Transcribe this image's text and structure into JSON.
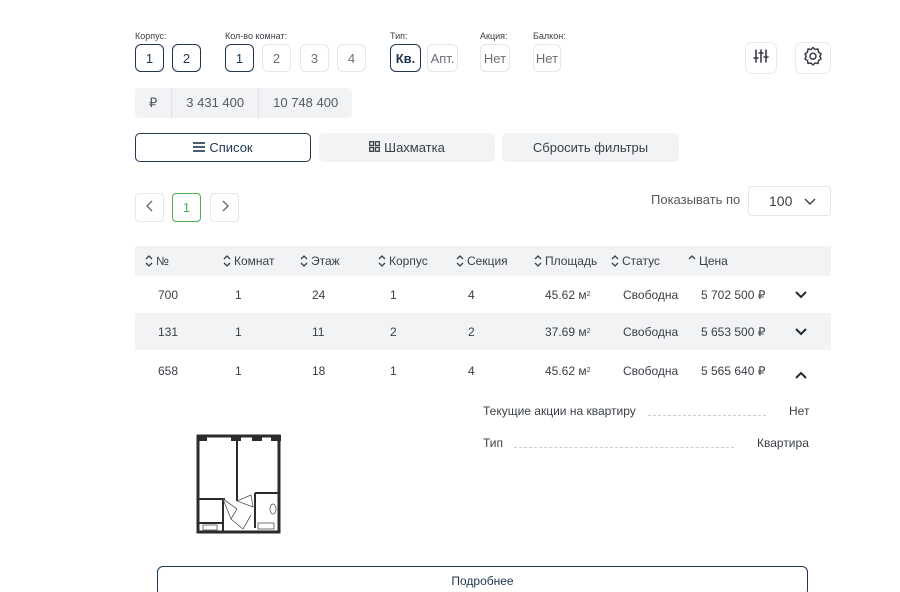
{
  "filters": {
    "korpus": {
      "label": "Корпус:",
      "options": [
        "1",
        "2"
      ]
    },
    "rooms": {
      "label": "Кол-во комнат:",
      "options": [
        "1",
        "2",
        "3",
        "4"
      ]
    },
    "type": {
      "label": "Тип:",
      "options": [
        "Кв.",
        "Апт."
      ]
    },
    "promo": {
      "label": "Акция:",
      "value": "Нет"
    },
    "balcony": {
      "label": "Балкон:",
      "value": "Нет"
    }
  },
  "price": {
    "currency": "₽",
    "min": "3 431 400",
    "max": "10 748 400"
  },
  "views": {
    "list": "Список",
    "grid": "Шахматка",
    "reset": "Сбросить фильтры"
  },
  "pagination": {
    "current": "1",
    "per_page_label": "Показывать по",
    "per_page_value": "100"
  },
  "table": {
    "headers": [
      "№",
      "Комнат",
      "Этаж",
      "Корпус",
      "Секция",
      "Площадь",
      "Статус",
      "Цена"
    ],
    "rows": [
      {
        "num": "700",
        "rooms": "1",
        "floor": "24",
        "korpus": "1",
        "section": "4",
        "area": "45.62 м",
        "sq": "2",
        "status": "Свободна",
        "price": "5 702 500 ₽"
      },
      {
        "num": "131",
        "rooms": "1",
        "floor": "11",
        "korpus": "2",
        "section": "2",
        "area": "37.69 м",
        "sq": "2",
        "status": "Свободна",
        "price": "5 653 500 ₽"
      },
      {
        "num": "658",
        "rooms": "1",
        "floor": "18",
        "korpus": "1",
        "section": "4",
        "area": "45.62 м",
        "sq": "2",
        "status": "Свободна",
        "price": "5 565 640 ₽"
      }
    ]
  },
  "detail": {
    "promo_label": "Текущие акции на квартиру",
    "promo_value": "Нет",
    "type_label": "Тип",
    "type_value": "Квартира",
    "more_button": "Подробнее"
  },
  "colors": {
    "accent": "#1f3550",
    "pager_active": "#4caf50",
    "row_alt": "#f2f3f5"
  }
}
